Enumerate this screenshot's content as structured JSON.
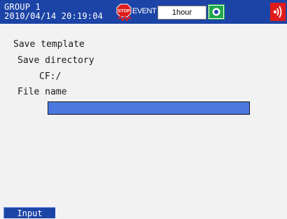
{
  "status_bar": {
    "group": "GROUP 1",
    "datetime": "2010/04/14 20:19:04",
    "stop_icon": "stop-icon",
    "event_label": "EVENT",
    "interval": "1hour",
    "toggle_icon": "toggle-icon",
    "alarm_icon": "alarm-icon"
  },
  "content": {
    "title": "Save template",
    "save_directory_label": "Save directory",
    "save_directory_value": "CF:/",
    "file_name_label": "File name",
    "file_name_value": ""
  },
  "softkeys": {
    "input_label": "Input"
  },
  "colors": {
    "header_bg": "#1c44a6",
    "field_bg": "#4c78e0",
    "page_bg": "#f2f2f2",
    "alarm_red": "#e01b1b"
  }
}
